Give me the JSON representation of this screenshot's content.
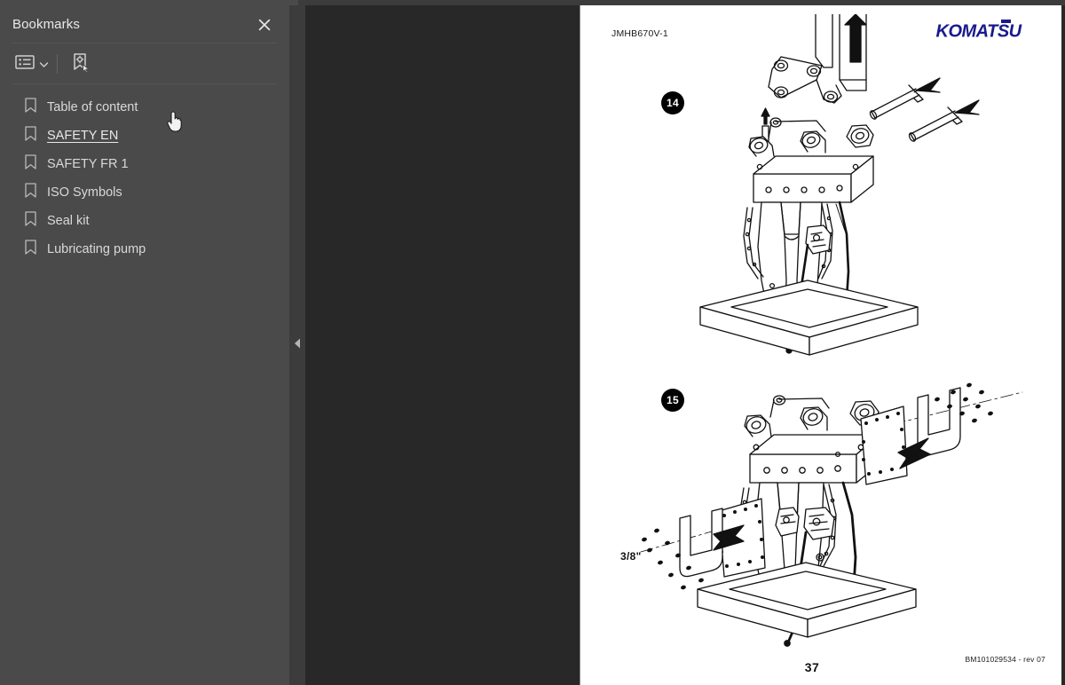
{
  "app": {
    "accent_blue": "#1a1a8c",
    "sidebar_bg": "#4a4a4a",
    "viewer_bg": "#282828"
  },
  "sidebar": {
    "title": "Bookmarks",
    "close_icon": "close-icon",
    "toolbar": {
      "list_view_icon": "bookmark-list-view-icon",
      "caret_icon": "chevron-down-icon",
      "new_bookmark_icon": "new-bookmark-icon"
    },
    "items": [
      {
        "label": "Table of content",
        "icon": "bookmark-icon",
        "hovered": false
      },
      {
        "label": "SAFETY EN",
        "icon": "bookmark-icon",
        "hovered": true
      },
      {
        "label": "SAFETY FR 1",
        "icon": "bookmark-icon",
        "hovered": false
      },
      {
        "label": "ISO Symbols",
        "icon": "bookmark-icon",
        "hovered": false
      },
      {
        "label": "Seal kit",
        "icon": "bookmark-icon",
        "hovered": false
      },
      {
        "label": "Lubricating pump",
        "icon": "bookmark-icon",
        "hovered": false
      }
    ]
  },
  "collapse_handle": {
    "icon": "chevron-left-icon"
  },
  "document": {
    "header_code": "JMHB670V-1",
    "brand": "KOMATSU",
    "page_number": "37",
    "footer_code": "BM101029534 - rev 07",
    "figures": [
      {
        "step": "14",
        "caption_icon": "excavator-arm-with-hammer-diagram",
        "labels": []
      },
      {
        "step": "15",
        "caption_icon": "hammer-side-plates-removal-diagram",
        "labels": [
          "3/8\""
        ]
      }
    ],
    "dimension_label": "3/8\""
  }
}
